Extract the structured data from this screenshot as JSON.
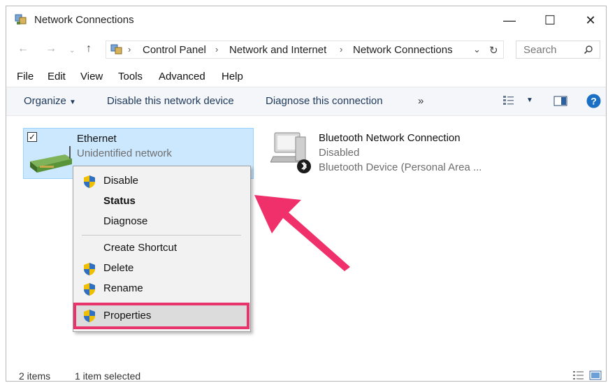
{
  "window": {
    "title": "Network Connections",
    "minimize_glyph": "—",
    "maximize_glyph": "☐",
    "close_glyph": "✕"
  },
  "address": {
    "crumbs": [
      "Control Panel",
      "Network and Internet",
      "Network Connections"
    ],
    "search_placeholder": "Search"
  },
  "menubar": [
    "File",
    "Edit",
    "View",
    "Tools",
    "Advanced",
    "Help"
  ],
  "commandbar": {
    "organize": "Organize",
    "disable": "Disable this network device",
    "diagnose": "Diagnose this connection",
    "more": "»"
  },
  "items": [
    {
      "name": "Ethernet",
      "status": "Unidentified network",
      "selected": true,
      "checked": "✓"
    },
    {
      "name": "Bluetooth Network Connection",
      "status": "Disabled",
      "device": "Bluetooth Device (Personal Area ..."
    }
  ],
  "context_menu": {
    "disable": "Disable",
    "status": "Status",
    "diagnose": "Diagnose",
    "create_shortcut": "Create Shortcut",
    "delete": "Delete",
    "rename": "Rename",
    "properties": "Properties"
  },
  "statusbar": {
    "count": "2 items",
    "selection": "1 item selected"
  },
  "colors": {
    "selection": "#cce8ff",
    "highlight": "#e8336d",
    "arrow": "#f0306a",
    "help": "#1a6fc4"
  }
}
